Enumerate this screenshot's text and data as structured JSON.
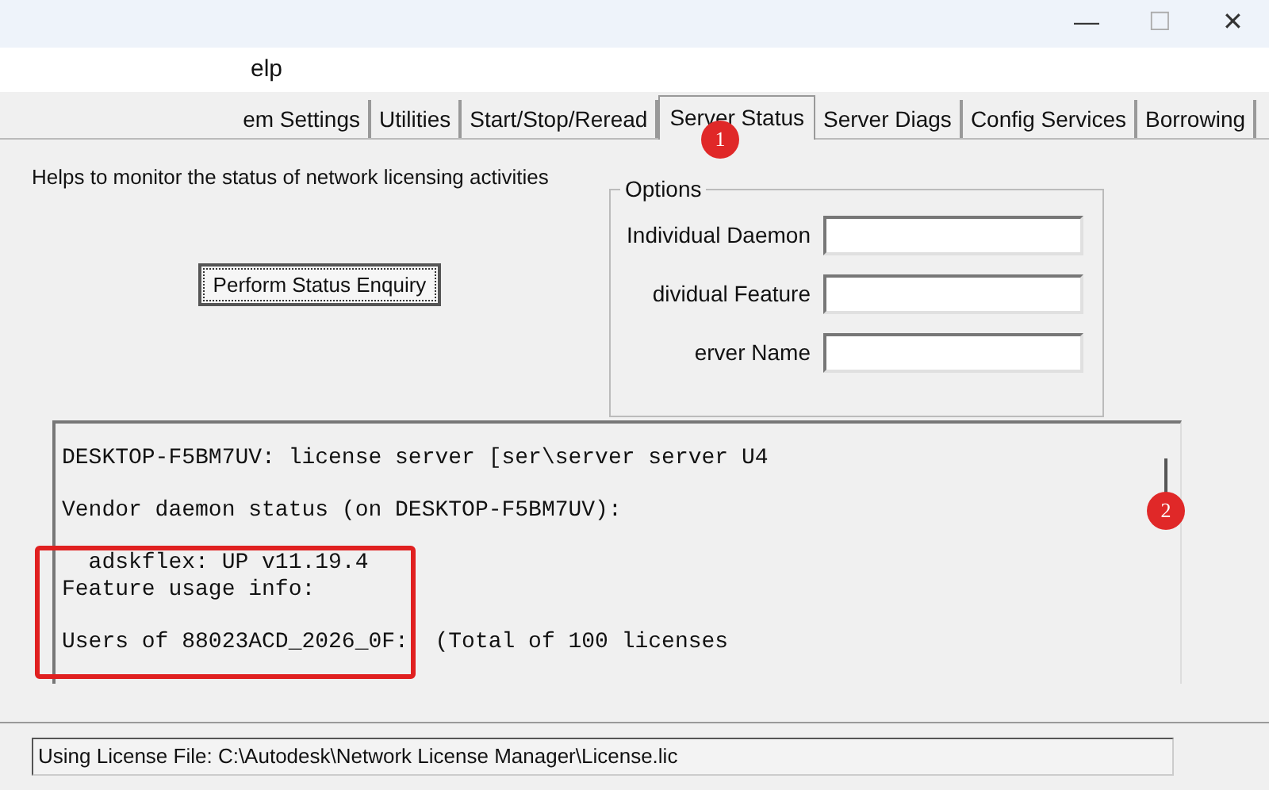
{
  "window": {
    "title": "elp",
    "controls": [
      "—",
      "☐",
      "✕"
    ]
  },
  "tabs": [
    {
      "label": "em Settings",
      "selected": false
    },
    {
      "label": "Utilities",
      "selected": false
    },
    {
      "label": "Start/Stop/Reread",
      "selected": false
    },
    {
      "label": "Server Status",
      "selected": true
    },
    {
      "label": "Server Diags",
      "selected": false
    },
    {
      "label": "Config Services",
      "selected": false
    },
    {
      "label": "Borrowing",
      "selected": false
    }
  ],
  "description": "Helps to monitor the status of network licensing activities",
  "status_button": "Perform Status Enquiry",
  "options": {
    "title": "Options",
    "fields": [
      {
        "label": "Individual Daemon"
      },
      {
        "label": "dividual Feature"
      },
      {
        "label": "erver Name"
      }
    ]
  },
  "output": {
    "paragraphs": [
      [
        "DESKTOP-F5BM7UV: license server [ser\\server server U4"
      ],
      [
        "Vendor daemon status (on DESKTOP-F5BM7UV):"
      ],
      [
        "  adskflex: UP v11.19.4",
        "Feature usage info:"
      ],
      [
        "Users of 88023ACD_2026_0F:  (Total of 100 licenses"
      ]
    ]
  },
  "annotations": [
    {
      "label": "1"
    },
    {
      "label": "2"
    }
  ],
  "status_bar": "Using License File:  C:\\Autodesk\\Network License Manager\\License.lic"
}
